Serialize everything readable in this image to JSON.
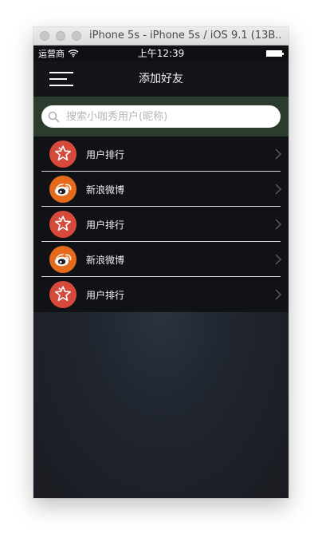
{
  "window": {
    "title": "iPhone 5s - iPhone 5s / iOS 9.1 (13B..."
  },
  "status_bar": {
    "carrier": "运营商",
    "time": "上午12:39"
  },
  "nav": {
    "title": "添加好友"
  },
  "search": {
    "placeholder": "搜索小咖秀用户(昵称)"
  },
  "list": {
    "items": [
      {
        "label": "用户排行",
        "icon": "star-icon",
        "color": "#d64a3c"
      },
      {
        "label": "新浪微博",
        "icon": "weibo-icon",
        "color": "#e46b1b"
      },
      {
        "label": "用户排行",
        "icon": "star-icon",
        "color": "#d64a3c"
      },
      {
        "label": "新浪微博",
        "icon": "weibo-icon",
        "color": "#e46b1b"
      },
      {
        "label": "用户排行",
        "icon": "star-icon",
        "color": "#d64a3c"
      }
    ]
  },
  "colors": {
    "search_bg": "#2b3b2e",
    "list_bg": "#111216"
  }
}
